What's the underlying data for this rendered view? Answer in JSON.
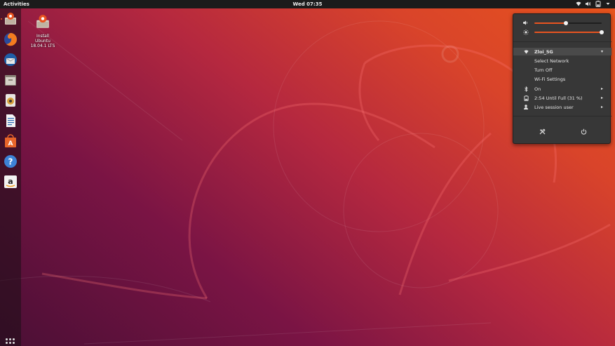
{
  "topbar": {
    "activities": "Activities",
    "clock": "Wed 07:35"
  },
  "desktop": {
    "install_icon": {
      "label_line1": "Install",
      "label_line2": "Ubuntu",
      "label_line3": "18.04.1 LTS"
    }
  },
  "dock": {
    "items": [
      {
        "name": "install-ubuntu",
        "running": true
      },
      {
        "name": "firefox"
      },
      {
        "name": "thunderbird"
      },
      {
        "name": "files"
      },
      {
        "name": "rhythmbox"
      },
      {
        "name": "libreoffice-writer"
      },
      {
        "name": "ubuntu-software"
      },
      {
        "name": "help"
      },
      {
        "name": "amazon"
      }
    ]
  },
  "system_menu": {
    "volume_level": 0.47,
    "brightness_level": 1.0,
    "wifi": {
      "network": "Zloi_5G",
      "select_network": "Select Network",
      "turn_off": "Turn Off",
      "settings": "Wi-Fi Settings"
    },
    "bluetooth": "On",
    "battery": "2:54 Until Full (31 %)",
    "user": "Live session user",
    "arrow": "▸",
    "dropdown_arrow": "▾"
  },
  "colors": {
    "accent": "#e95420",
    "topbar": "#1b1b1b",
    "menu_bg": "#373737"
  }
}
